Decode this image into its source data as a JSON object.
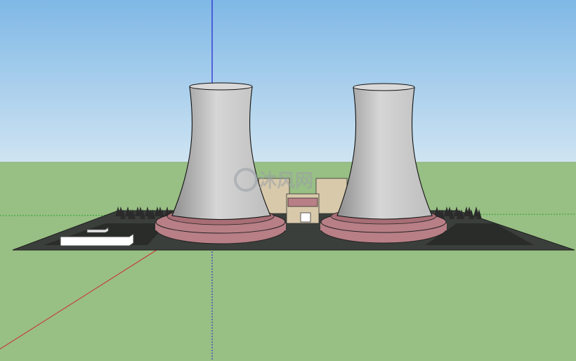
{
  "viewport": {
    "sky_top_color": "#7fb8e6",
    "sky_bottom_color": "#cfe4f2",
    "ground_color": "#98bf84",
    "horizon_color": "#8fb07a"
  },
  "axes": {
    "blue_axis_color": "#2222cc",
    "red_axis_color": "#cc2a2a",
    "green_axis_color": "#2aa52a"
  },
  "model": {
    "base_slab_color": "#3b3f3b",
    "road_color": "#2a2c2a",
    "cooling_tower_color": "#c9c9c9",
    "tower_base_color": "#b87f86",
    "building_color": "#d8c9ab",
    "building_roof_color": "#b87f86",
    "white_block_color": "#ffffff",
    "tree_color": "#2b2b2b"
  },
  "watermark": {
    "logo_text": "沐风网",
    "color": "#9aa0a6"
  }
}
